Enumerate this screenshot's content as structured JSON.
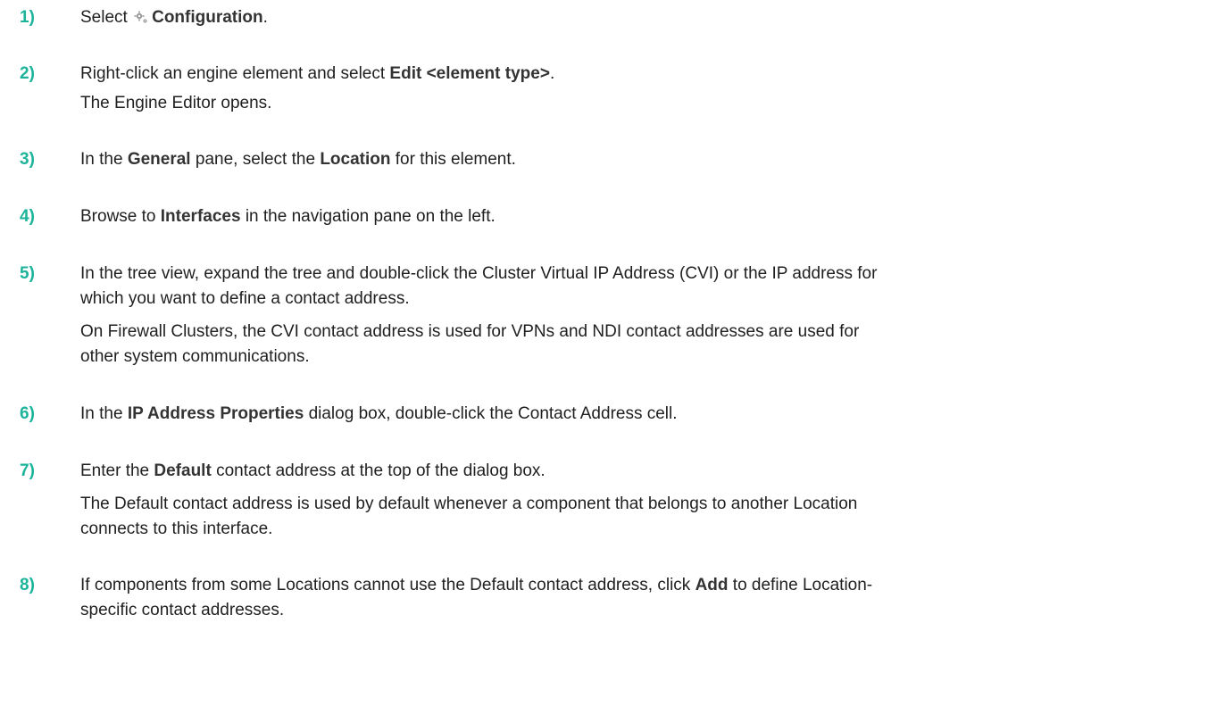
{
  "steps": [
    {
      "number": "1)",
      "line1": {
        "pre": "Select ",
        "icon": "gear-icon",
        "bold": "Configuration",
        "post": "."
      }
    },
    {
      "number": "2)",
      "line1": {
        "pre": "Right-click an engine element and select ",
        "bold": "Edit <element type>",
        "post": "."
      },
      "result": "The Engine Editor opens."
    },
    {
      "number": "3)",
      "line1": {
        "pre": "In the ",
        "bold": "General",
        "mid": " pane, select the ",
        "bold2": "Location",
        "post": " for this element."
      }
    },
    {
      "number": "4)",
      "line1": {
        "pre": "Browse to ",
        "bold": "Interfaces",
        "post": " in the navigation pane on the left."
      }
    },
    {
      "number": "5)",
      "text_a": "In the tree view, expand the tree and double-click the Cluster Virtual IP Address (CVI) or the IP address for",
      "text_b": "which you want to define a contact address.",
      "result_a": "On Firewall Clusters, the CVI contact address is used for VPNs and NDI contact addresses are used for",
      "result_b": "other system communications."
    },
    {
      "number": "6)",
      "line1": {
        "pre": "In the ",
        "bold": "IP Address Properties",
        "post": " dialog box, double-click the Contact Address cell."
      }
    },
    {
      "number": "7)",
      "line1": {
        "pre": "Enter the ",
        "bold": "Default",
        "post": " contact address at the top of the dialog box."
      },
      "result_a": "The Default contact address is used by default whenever a component that belongs to another Location",
      "result_b": "connects to this interface."
    },
    {
      "number": "8)",
      "line1": {
        "pre": "If components from some Locations cannot use the Default contact address, click ",
        "bold": "Add",
        "post": " to define Location-"
      },
      "line2": "specific contact addresses."
    }
  ],
  "colors": {
    "step_number": "#1bb39a",
    "text": "#1f1f1f",
    "bold_text": "#333333",
    "icon": "#9a9a9a"
  }
}
